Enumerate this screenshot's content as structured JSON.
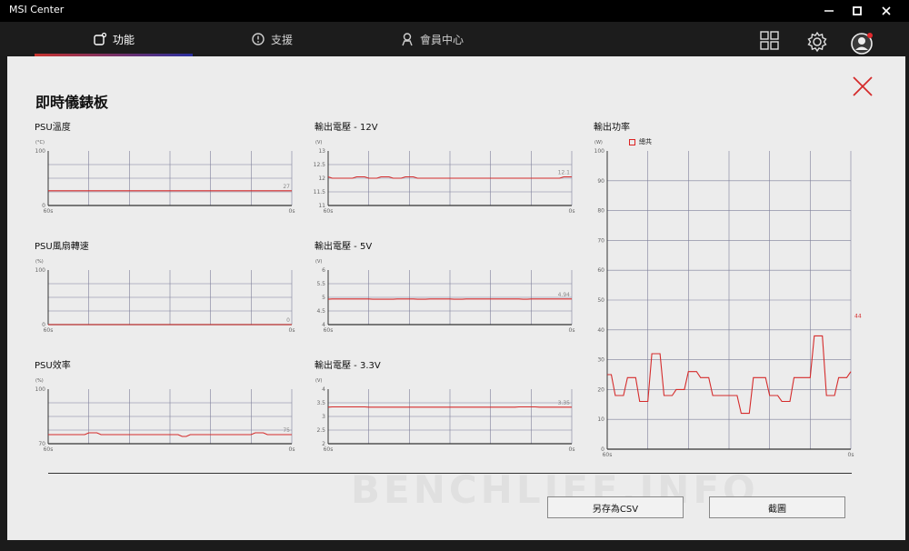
{
  "app": {
    "title": "MSI Center"
  },
  "nav": {
    "tabs": [
      {
        "label": "功能",
        "icon": "feature-icon"
      },
      {
        "label": "支援",
        "icon": "support-icon"
      },
      {
        "label": "會員中心",
        "icon": "member-icon"
      }
    ]
  },
  "dashboard": {
    "title": "即時儀錶板",
    "colors": {
      "line": "#d52b2b",
      "grid": "#7e7f9a",
      "axis": "#333333"
    }
  },
  "buttons": {
    "export_csv": "另存為CSV",
    "screenshot": "截圖"
  },
  "watermark": "BENCHLIFE.INFO",
  "chart_data": [
    {
      "type": "line",
      "title": "PSU溫度",
      "unit": "(°C)",
      "yticks": [
        "100",
        "0"
      ],
      "ylim": [
        0,
        100
      ],
      "xticks": [
        "60s",
        "0s"
      ],
      "current_label": "27",
      "values": [
        27,
        27,
        27,
        27,
        27,
        27,
        27,
        27,
        27,
        27,
        27,
        27,
        27,
        27,
        27,
        27,
        27,
        27,
        27,
        27,
        27,
        27,
        27,
        27,
        27,
        27,
        27,
        27,
        27,
        27,
        27,
        27,
        27,
        27,
        27,
        27,
        27,
        27,
        27,
        27,
        27,
        27,
        27,
        27,
        27,
        27,
        27,
        27,
        27,
        27,
        27,
        27,
        27,
        27,
        27,
        27,
        27,
        27,
        27,
        27,
        27
      ]
    },
    {
      "type": "line",
      "title": "PSU風扇轉速",
      "unit": "(%)",
      "yticks": [
        "100",
        "0"
      ],
      "ylim": [
        0,
        100
      ],
      "xticks": [
        "60s",
        "0s"
      ],
      "current_label": "0",
      "values": [
        0,
        0,
        0,
        0,
        0,
        0,
        0,
        0,
        0,
        0,
        0,
        0,
        0,
        0,
        0,
        0,
        0,
        0,
        0,
        0,
        0,
        0,
        0,
        0,
        0,
        0,
        0,
        0,
        0,
        0,
        0,
        0,
        0,
        0,
        0,
        0,
        0,
        0,
        0,
        0,
        0,
        0,
        0,
        0,
        0,
        0,
        0,
        0,
        0,
        0,
        0,
        0,
        0,
        0,
        0,
        0,
        0,
        0,
        0,
        0,
        0
      ]
    },
    {
      "type": "line",
      "title": "PSU效率",
      "unit": "(%)",
      "yticks": [
        "100",
        "70"
      ],
      "ylim": [
        70,
        100
      ],
      "xticks": [
        "60s",
        "0s"
      ],
      "current_label": "75",
      "values": [
        75,
        75,
        75,
        75,
        75,
        75,
        75,
        75,
        75,
        75,
        76,
        76,
        76,
        75,
        75,
        75,
        75,
        75,
        75,
        75,
        75,
        75,
        75,
        75,
        75,
        75,
        75,
        75,
        75,
        75,
        75,
        75,
        75,
        74,
        74,
        75,
        75,
        75,
        75,
        75,
        75,
        75,
        75,
        75,
        75,
        75,
        75,
        75,
        75,
        75,
        75,
        76,
        76,
        76,
        75,
        75,
        75,
        75,
        75,
        75,
        75
      ]
    },
    {
      "type": "line",
      "title": "輸出電壓 - 12V",
      "unit": "(V)",
      "yticks": [
        "13",
        "12.5",
        "12",
        "11.5",
        "11"
      ],
      "ylim": [
        11,
        13
      ],
      "xticks": [
        "60s",
        "0s"
      ],
      "current_label": "12.1",
      "values": [
        12.05,
        12.0,
        12.0,
        12.0,
        12.0,
        12.0,
        12.0,
        12.05,
        12.05,
        12.05,
        12.0,
        12.0,
        12.0,
        12.05,
        12.05,
        12.05,
        12.0,
        12.0,
        12.0,
        12.05,
        12.05,
        12.05,
        12.0,
        12.0,
        12.0,
        12.0,
        12.0,
        12.0,
        12.0,
        12.0,
        12.0,
        12.0,
        12.0,
        12.0,
        12.0,
        12.0,
        12.0,
        12.0,
        12.0,
        12.0,
        12.0,
        12.0,
        12.0,
        12.0,
        12.0,
        12.0,
        12.0,
        12.0,
        12.0,
        12.0,
        12.0,
        12.0,
        12.0,
        12.0,
        12.0,
        12.0,
        12.0,
        12.0,
        12.05,
        12.05,
        12.05
      ]
    },
    {
      "type": "line",
      "title": "輸出電壓 - 5V",
      "unit": "(V)",
      "yticks": [
        "6",
        "5.5",
        "5",
        "4.5",
        "4"
      ],
      "ylim": [
        4,
        6
      ],
      "xticks": [
        "60s",
        "0s"
      ],
      "current_label": "4.94",
      "values": [
        4.93,
        4.94,
        4.94,
        4.94,
        4.94,
        4.94,
        4.94,
        4.94,
        4.94,
        4.94,
        4.94,
        4.93,
        4.93,
        4.93,
        4.93,
        4.93,
        4.93,
        4.94,
        4.94,
        4.94,
        4.94,
        4.94,
        4.93,
        4.93,
        4.93,
        4.94,
        4.94,
        4.94,
        4.94,
        4.94,
        4.94,
        4.93,
        4.93,
        4.93,
        4.94,
        4.94,
        4.94,
        4.94,
        4.94,
        4.94,
        4.94,
        4.94,
        4.94,
        4.94,
        4.94,
        4.94,
        4.94,
        4.94,
        4.93,
        4.93,
        4.94,
        4.94,
        4.94,
        4.94,
        4.94,
        4.94,
        4.94,
        4.94,
        4.94,
        4.94,
        4.94
      ]
    },
    {
      "type": "line",
      "title": "輸出電壓 - 3.3V",
      "unit": "(V)",
      "yticks": [
        "4",
        "3.5",
        "3",
        "2.5",
        "2"
      ],
      "ylim": [
        2,
        4
      ],
      "xticks": [
        "60s",
        "0s"
      ],
      "current_label": "3.35",
      "values": [
        3.34,
        3.35,
        3.35,
        3.35,
        3.35,
        3.35,
        3.35,
        3.35,
        3.35,
        3.35,
        3.34,
        3.34,
        3.34,
        3.34,
        3.34,
        3.34,
        3.34,
        3.34,
        3.34,
        3.34,
        3.34,
        3.34,
        3.34,
        3.34,
        3.34,
        3.34,
        3.34,
        3.34,
        3.34,
        3.34,
        3.34,
        3.34,
        3.34,
        3.34,
        3.34,
        3.34,
        3.34,
        3.34,
        3.34,
        3.34,
        3.34,
        3.34,
        3.34,
        3.34,
        3.34,
        3.34,
        3.34,
        3.35,
        3.35,
        3.35,
        3.35,
        3.35,
        3.34,
        3.34,
        3.34,
        3.34,
        3.34,
        3.34,
        3.34,
        3.34,
        3.34
      ]
    },
    {
      "type": "line",
      "title": "輸出功率",
      "unit": "(W)",
      "legend": "總共",
      "yticks": [
        "100",
        "90",
        "80",
        "70",
        "60",
        "50",
        "40",
        "30",
        "20",
        "10",
        "0"
      ],
      "ylim": [
        0,
        100
      ],
      "xticks": [
        "60s",
        "0s"
      ],
      "current_label": "44",
      "values": [
        25,
        25,
        18,
        18,
        18,
        24,
        24,
        24,
        16,
        16,
        16,
        32,
        32,
        32,
        18,
        18,
        18,
        20,
        20,
        20,
        26,
        26,
        26,
        24,
        24,
        24,
        18,
        18,
        18,
        18,
        18,
        18,
        18,
        12,
        12,
        12,
        24,
        24,
        24,
        24,
        18,
        18,
        18,
        16,
        16,
        16,
        24,
        24,
        24,
        24,
        24,
        38,
        38,
        38,
        18,
        18,
        18,
        24,
        24,
        24,
        26
      ]
    }
  ]
}
